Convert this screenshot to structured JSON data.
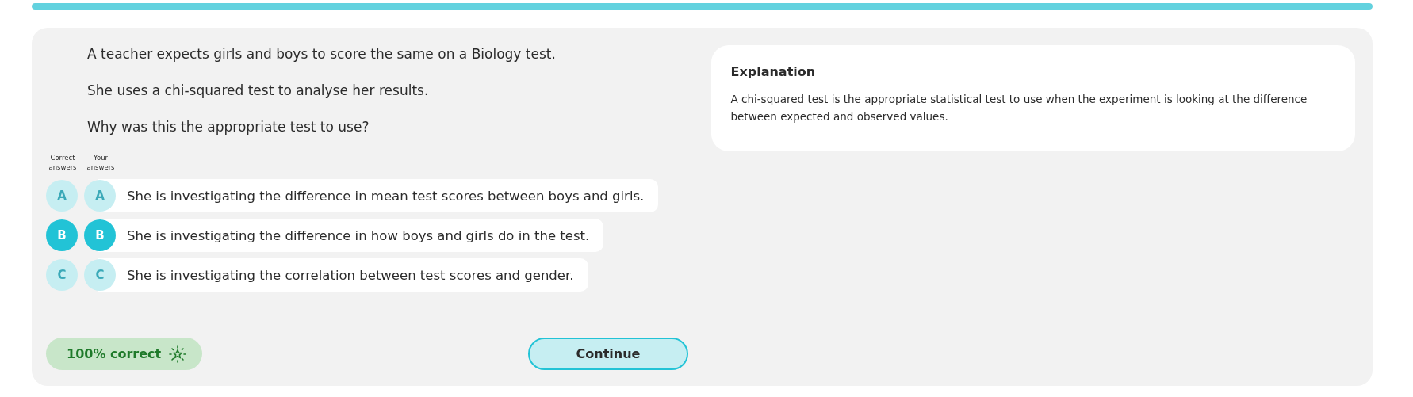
{
  "progress": {
    "level": 1
  },
  "question": [
    "A teacher expects girls and boys to score the same on a Biology test.",
    "She uses a chi-squared test to analyse her results.",
    "Why was this the appropriate test to use?"
  ],
  "answer_headers": {
    "correct": "Correct answers",
    "yours": "Your answers"
  },
  "options": [
    {
      "correct_letter": "A",
      "your_letter": "A",
      "text": "She is investigating the difference in mean test scores between boys and girls.",
      "correct": false,
      "selected": false
    },
    {
      "correct_letter": "B",
      "your_letter": "B",
      "text": "She is investigating the difference in how boys and girls do in the test.",
      "correct": true,
      "selected": true
    },
    {
      "correct_letter": "C",
      "your_letter": "C",
      "text": "She is investigating the correlation between test scores and gender.",
      "correct": false,
      "selected": false
    }
  ],
  "score": "100% correct",
  "continue_button": "Continue",
  "explanation": {
    "title": "Explanation",
    "text": "A chi-squared test is the appropriate statistical test to use when the experiment is looking at the difference between expected and observed values."
  }
}
